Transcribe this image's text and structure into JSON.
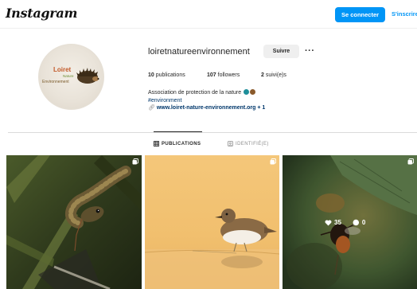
{
  "topbar": {
    "logo": "Instagram",
    "login_label": "Se connecter",
    "signup_label": "S'inscrire"
  },
  "profile": {
    "avatar_text": {
      "line1": "Loiret",
      "line2": "Nature",
      "line3": "Environnement"
    },
    "username": "loiretnatureenvironnement",
    "follow_label": "Suivre",
    "more_label": "···",
    "stats": [
      {
        "count": "10",
        "label": "publications"
      },
      {
        "count": "107",
        "label": "followers"
      },
      {
        "count": "2",
        "label": "suivi(e)s"
      }
    ],
    "bio_line": "Association de protection de la nature",
    "hashtag": "#environment",
    "link": "www.loiret-nature-environnement.org",
    "link_extra": "+ 1"
  },
  "tabs": [
    {
      "label": "PUBLICATIONS",
      "active": true
    },
    {
      "label": "IDENTIFIÉ(E)",
      "active": false
    }
  ],
  "posts": [
    {
      "subject": "snake",
      "multiple": true
    },
    {
      "subject": "sandpiper",
      "multiple": true
    },
    {
      "subject": "bee",
      "multiple": true,
      "likes": "35",
      "comments": "0"
    }
  ],
  "colors": {
    "accent": "#0095f6",
    "text": "#262626",
    "muted": "#8e8e8e",
    "link": "#00376b"
  }
}
